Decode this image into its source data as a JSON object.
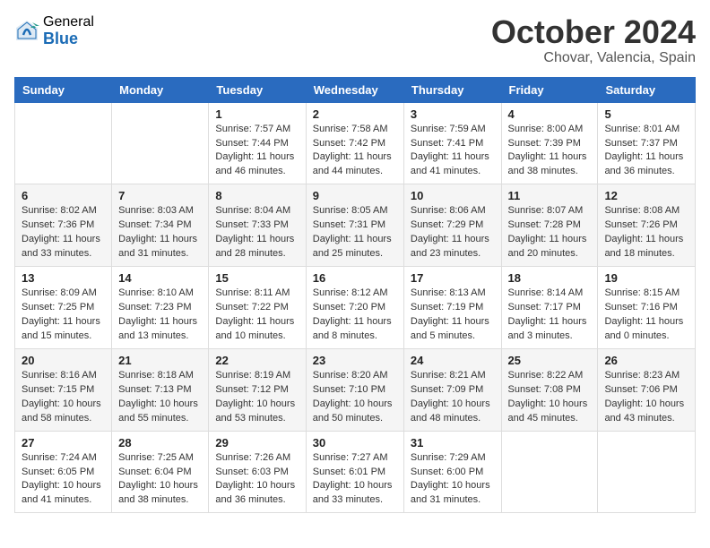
{
  "logo": {
    "general": "General",
    "blue": "Blue"
  },
  "header": {
    "month": "October 2024",
    "location": "Chovar, Valencia, Spain"
  },
  "weekdays": [
    "Sunday",
    "Monday",
    "Tuesday",
    "Wednesday",
    "Thursday",
    "Friday",
    "Saturday"
  ],
  "weeks": [
    [
      {
        "day": "",
        "sunrise": "",
        "sunset": "",
        "daylight": ""
      },
      {
        "day": "",
        "sunrise": "",
        "sunset": "",
        "daylight": ""
      },
      {
        "day": "1",
        "sunrise": "Sunrise: 7:57 AM",
        "sunset": "Sunset: 7:44 PM",
        "daylight": "Daylight: 11 hours and 46 minutes."
      },
      {
        "day": "2",
        "sunrise": "Sunrise: 7:58 AM",
        "sunset": "Sunset: 7:42 PM",
        "daylight": "Daylight: 11 hours and 44 minutes."
      },
      {
        "day": "3",
        "sunrise": "Sunrise: 7:59 AM",
        "sunset": "Sunset: 7:41 PM",
        "daylight": "Daylight: 11 hours and 41 minutes."
      },
      {
        "day": "4",
        "sunrise": "Sunrise: 8:00 AM",
        "sunset": "Sunset: 7:39 PM",
        "daylight": "Daylight: 11 hours and 38 minutes."
      },
      {
        "day": "5",
        "sunrise": "Sunrise: 8:01 AM",
        "sunset": "Sunset: 7:37 PM",
        "daylight": "Daylight: 11 hours and 36 minutes."
      }
    ],
    [
      {
        "day": "6",
        "sunrise": "Sunrise: 8:02 AM",
        "sunset": "Sunset: 7:36 PM",
        "daylight": "Daylight: 11 hours and 33 minutes."
      },
      {
        "day": "7",
        "sunrise": "Sunrise: 8:03 AM",
        "sunset": "Sunset: 7:34 PM",
        "daylight": "Daylight: 11 hours and 31 minutes."
      },
      {
        "day": "8",
        "sunrise": "Sunrise: 8:04 AM",
        "sunset": "Sunset: 7:33 PM",
        "daylight": "Daylight: 11 hours and 28 minutes."
      },
      {
        "day": "9",
        "sunrise": "Sunrise: 8:05 AM",
        "sunset": "Sunset: 7:31 PM",
        "daylight": "Daylight: 11 hours and 25 minutes."
      },
      {
        "day": "10",
        "sunrise": "Sunrise: 8:06 AM",
        "sunset": "Sunset: 7:29 PM",
        "daylight": "Daylight: 11 hours and 23 minutes."
      },
      {
        "day": "11",
        "sunrise": "Sunrise: 8:07 AM",
        "sunset": "Sunset: 7:28 PM",
        "daylight": "Daylight: 11 hours and 20 minutes."
      },
      {
        "day": "12",
        "sunrise": "Sunrise: 8:08 AM",
        "sunset": "Sunset: 7:26 PM",
        "daylight": "Daylight: 11 hours and 18 minutes."
      }
    ],
    [
      {
        "day": "13",
        "sunrise": "Sunrise: 8:09 AM",
        "sunset": "Sunset: 7:25 PM",
        "daylight": "Daylight: 11 hours and 15 minutes."
      },
      {
        "day": "14",
        "sunrise": "Sunrise: 8:10 AM",
        "sunset": "Sunset: 7:23 PM",
        "daylight": "Daylight: 11 hours and 13 minutes."
      },
      {
        "day": "15",
        "sunrise": "Sunrise: 8:11 AM",
        "sunset": "Sunset: 7:22 PM",
        "daylight": "Daylight: 11 hours and 10 minutes."
      },
      {
        "day": "16",
        "sunrise": "Sunrise: 8:12 AM",
        "sunset": "Sunset: 7:20 PM",
        "daylight": "Daylight: 11 hours and 8 minutes."
      },
      {
        "day": "17",
        "sunrise": "Sunrise: 8:13 AM",
        "sunset": "Sunset: 7:19 PM",
        "daylight": "Daylight: 11 hours and 5 minutes."
      },
      {
        "day": "18",
        "sunrise": "Sunrise: 8:14 AM",
        "sunset": "Sunset: 7:17 PM",
        "daylight": "Daylight: 11 hours and 3 minutes."
      },
      {
        "day": "19",
        "sunrise": "Sunrise: 8:15 AM",
        "sunset": "Sunset: 7:16 PM",
        "daylight": "Daylight: 11 hours and 0 minutes."
      }
    ],
    [
      {
        "day": "20",
        "sunrise": "Sunrise: 8:16 AM",
        "sunset": "Sunset: 7:15 PM",
        "daylight": "Daylight: 10 hours and 58 minutes."
      },
      {
        "day": "21",
        "sunrise": "Sunrise: 8:18 AM",
        "sunset": "Sunset: 7:13 PM",
        "daylight": "Daylight: 10 hours and 55 minutes."
      },
      {
        "day": "22",
        "sunrise": "Sunrise: 8:19 AM",
        "sunset": "Sunset: 7:12 PM",
        "daylight": "Daylight: 10 hours and 53 minutes."
      },
      {
        "day": "23",
        "sunrise": "Sunrise: 8:20 AM",
        "sunset": "Sunset: 7:10 PM",
        "daylight": "Daylight: 10 hours and 50 minutes."
      },
      {
        "day": "24",
        "sunrise": "Sunrise: 8:21 AM",
        "sunset": "Sunset: 7:09 PM",
        "daylight": "Daylight: 10 hours and 48 minutes."
      },
      {
        "day": "25",
        "sunrise": "Sunrise: 8:22 AM",
        "sunset": "Sunset: 7:08 PM",
        "daylight": "Daylight: 10 hours and 45 minutes."
      },
      {
        "day": "26",
        "sunrise": "Sunrise: 8:23 AM",
        "sunset": "Sunset: 7:06 PM",
        "daylight": "Daylight: 10 hours and 43 minutes."
      }
    ],
    [
      {
        "day": "27",
        "sunrise": "Sunrise: 7:24 AM",
        "sunset": "Sunset: 6:05 PM",
        "daylight": "Daylight: 10 hours and 41 minutes."
      },
      {
        "day": "28",
        "sunrise": "Sunrise: 7:25 AM",
        "sunset": "Sunset: 6:04 PM",
        "daylight": "Daylight: 10 hours and 38 minutes."
      },
      {
        "day": "29",
        "sunrise": "Sunrise: 7:26 AM",
        "sunset": "Sunset: 6:03 PM",
        "daylight": "Daylight: 10 hours and 36 minutes."
      },
      {
        "day": "30",
        "sunrise": "Sunrise: 7:27 AM",
        "sunset": "Sunset: 6:01 PM",
        "daylight": "Daylight: 10 hours and 33 minutes."
      },
      {
        "day": "31",
        "sunrise": "Sunrise: 7:29 AM",
        "sunset": "Sunset: 6:00 PM",
        "daylight": "Daylight: 10 hours and 31 minutes."
      },
      {
        "day": "",
        "sunrise": "",
        "sunset": "",
        "daylight": ""
      },
      {
        "day": "",
        "sunrise": "",
        "sunset": "",
        "daylight": ""
      }
    ]
  ]
}
